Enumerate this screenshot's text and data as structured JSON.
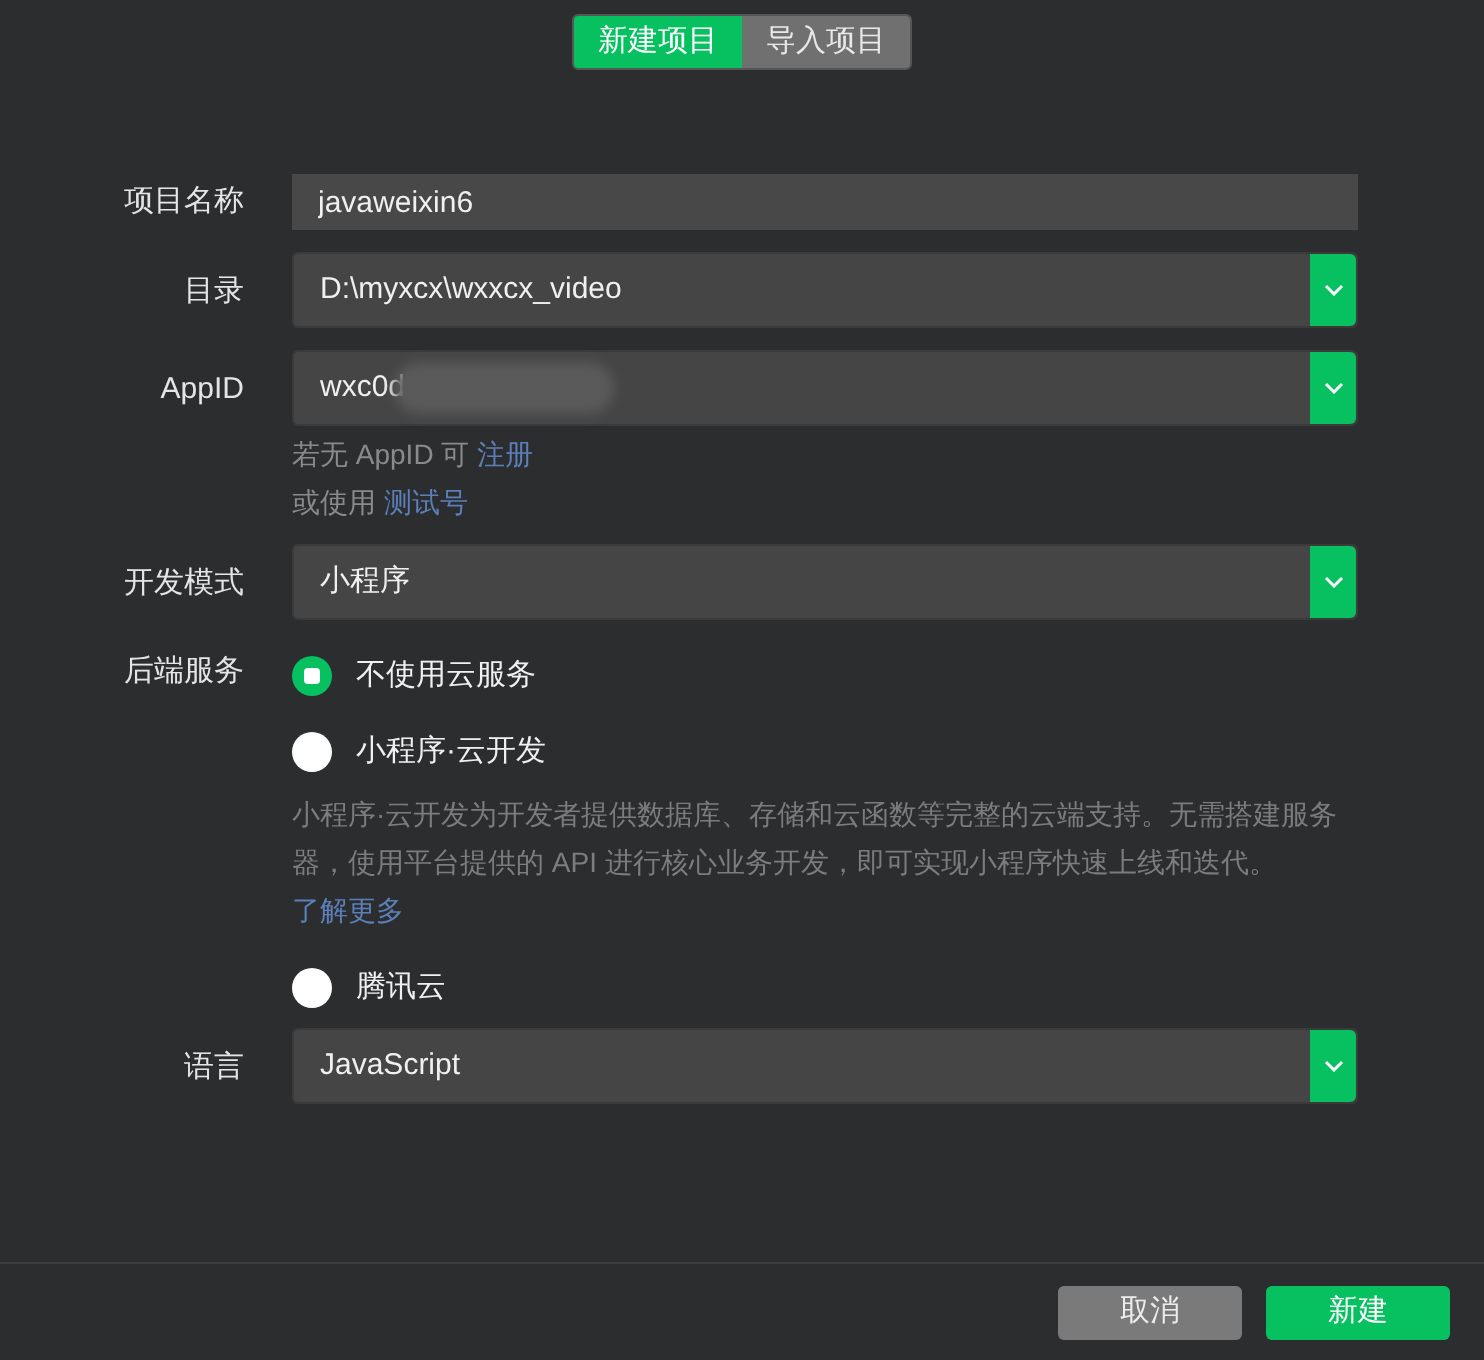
{
  "tabs": [
    {
      "label": "新建项目",
      "selected": true
    },
    {
      "label": "导入项目",
      "selected": false
    }
  ],
  "fields": [
    {
      "kind": "text",
      "label": "项目名称",
      "value": "javaweixin6"
    },
    {
      "kind": "select",
      "label": "目录",
      "value": "D:\\myxcx\\wxxcx_video"
    },
    {
      "kind": "select",
      "label": "AppID",
      "value": "wxc0d",
      "redacted": true,
      "hints": [
        {
          "text": "若无 AppID 可",
          "link": "注册"
        },
        {
          "text": "或使用",
          "link": "测试号"
        }
      ]
    },
    {
      "kind": "select",
      "label": "开发模式",
      "value": "小程序"
    },
    {
      "kind": "radios",
      "label": "后端服务",
      "options": [
        {
          "label": "不使用云服务",
          "selected": true
        },
        {
          "label": "小程序·云开发",
          "selected": false,
          "description": "小程序·云开发为开发者提供数据库、存储和云函数等完整的云端支持。无需搭建服务器，使用平台提供的 API 进行核心业务开发，即可实现小程序快速上线和迭代。",
          "link": "了解更多"
        },
        {
          "label": "腾讯云",
          "selected": false
        }
      ]
    },
    {
      "kind": "select",
      "label": "语言",
      "value": "JavaScript"
    }
  ],
  "buttons": [
    {
      "label": "取消",
      "primary": false
    },
    {
      "label": "新建",
      "primary": true
    }
  ]
}
